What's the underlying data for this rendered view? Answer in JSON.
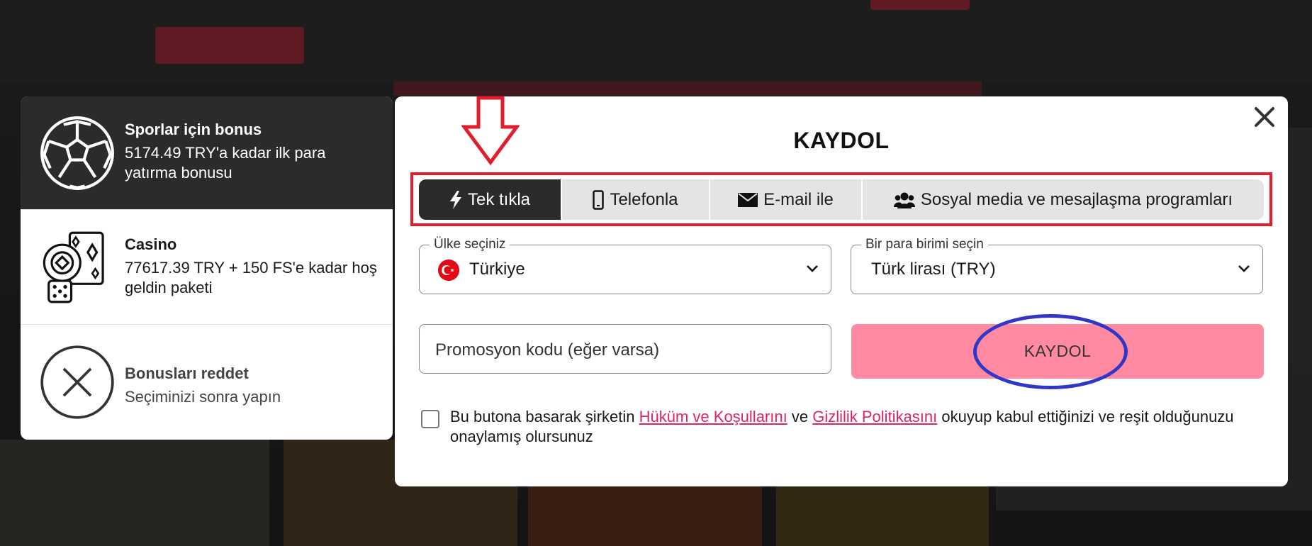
{
  "bonuses": [
    {
      "title": "Sporlar için bonus",
      "desc": "5174.49 TRY'a kadar ilk para yatırma bonusu",
      "icon": "soccer-ball-icon",
      "selected": true
    },
    {
      "title": "Casino",
      "desc": "77617.39 TRY + 150 FS'e kadar hoş geldin paketi",
      "icon": "casino-chips-cards-dice-icon",
      "selected": false
    },
    {
      "title": "Bonusları reddet",
      "desc": "Seçiminizi sonra yapın",
      "icon": "circle-x-icon",
      "selected": false
    }
  ],
  "modal": {
    "title": "KAYDOL",
    "tabs": [
      {
        "label": "Tek tıkla",
        "icon": "lightning-icon",
        "active": true
      },
      {
        "label": "Telefonla",
        "icon": "phone-icon",
        "active": false
      },
      {
        "label": "E-mail ile",
        "icon": "envelope-icon",
        "active": false
      },
      {
        "label": "Sosyal media ve mesajlaşma programları",
        "icon": "users-icon",
        "active": false
      }
    ],
    "country": {
      "label": "Ülke seçiniz",
      "value": "Türkiye",
      "flag": "turkey-flag"
    },
    "currency": {
      "label": "Bir para birimi seçin",
      "value": "Türk lirası (TRY)"
    },
    "promo": {
      "placeholder": "Promosyon kodu (eğer varsa)"
    },
    "register_button": "KAYDOL",
    "consent": {
      "prefix": "Bu butona basarak şirketin",
      "link1": "Hüküm ve Koşullarını",
      "middle": "ve",
      "link2": "Gizlilik Politikasını",
      "suffix": "okuyup kabul ettiğinizi ve reşit olduğunuzu onaylamış olursunuz",
      "checked": false
    }
  },
  "colors": {
    "accent_pink": "#ff8aa1",
    "link": "#e0245e",
    "annotation_red": "#e01e2e",
    "annotation_blue": "#3136c8",
    "dark": "#2b2b2b"
  }
}
